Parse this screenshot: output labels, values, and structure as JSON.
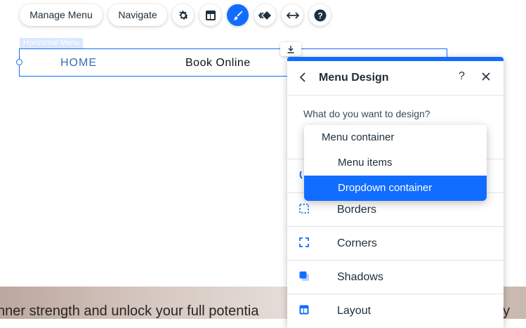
{
  "toolbar": {
    "manage_menu": "Manage Menu",
    "navigate": "Navigate",
    "icons": [
      "settings-icon",
      "layout-icon",
      "design-brush-icon",
      "animation-icon",
      "stretch-icon",
      "help-icon"
    ]
  },
  "menu_element": {
    "tag": "Horizontal Menu",
    "items": [
      "HOME",
      "Book Online"
    ]
  },
  "background": {
    "text": "nner strength and unlock your full potentia",
    "tail": "y"
  },
  "panel": {
    "title": "Menu Design",
    "help": "?",
    "question": "What do you want to design?",
    "rows": [
      {
        "label": "Borders",
        "icon": "borders-icon"
      },
      {
        "label": "Corners",
        "icon": "corners-icon"
      },
      {
        "label": "Shadows",
        "icon": "shadows-icon"
      },
      {
        "label": "Layout",
        "icon": "layout-icon"
      }
    ]
  },
  "dropdown": {
    "options": [
      "Menu container",
      "Menu items",
      "Dropdown container"
    ],
    "selected": "Dropdown container"
  },
  "colors": {
    "accent": "#116dff",
    "text": "#20303c"
  }
}
